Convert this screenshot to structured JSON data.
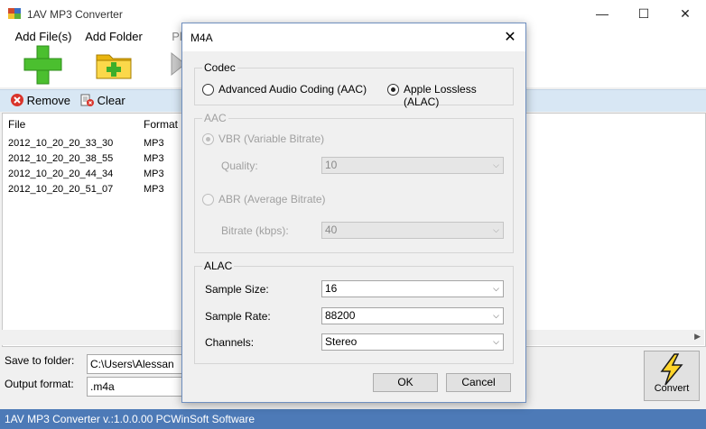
{
  "window": {
    "title": "1AV MP3 Converter",
    "minimize_icon": "minimize-icon",
    "maximize_icon": "maximize-icon",
    "close_icon": "close-icon"
  },
  "toolbar": {
    "add_files_label": "Add File(s)",
    "add_folder_label": "Add Folder",
    "play_label": "Pl"
  },
  "subbar": {
    "remove_label": "Remove",
    "clear_label": "Clear"
  },
  "file_list": {
    "columns": [
      "File",
      "Format"
    ],
    "rows": [
      {
        "file": "2012_10_20_20_33_30",
        "format": "MP3"
      },
      {
        "file": "2012_10_20_20_38_55",
        "format": "MP3"
      },
      {
        "file": "2012_10_20_20_44_34",
        "format": "MP3"
      },
      {
        "file": "2012_10_20_20_51_07",
        "format": "MP3"
      }
    ]
  },
  "bottom": {
    "save_folder_label": "Save to folder:",
    "save_folder_value": "C:\\Users\\Alessan",
    "output_format_label": "Output format:",
    "output_format_value": ".m4a",
    "convert_label": "Convert"
  },
  "status": "1AV MP3 Converter v.:1.0.0.00 PCWinSoft Software",
  "dialog": {
    "title": "M4A",
    "codec_group": "Codec",
    "codec_aac": "Advanced Audio Coding (AAC)",
    "codec_alac": "Apple Lossless (ALAC)",
    "aac_group": "AAC",
    "vbr_label": "VBR (Variable Bitrate)",
    "quality_label": "Quality:",
    "quality_value": "10",
    "abr_label": "ABR (Average Bitrate)",
    "bitrate_label": "Bitrate (kbps):",
    "bitrate_value": "40",
    "alac_group": "ALAC",
    "sample_size_label": "Sample Size:",
    "sample_size_value": "16",
    "sample_rate_label": "Sample Rate:",
    "sample_rate_value": "88200",
    "channels_label": "Channels:",
    "channels_value": "Stereo",
    "ok_label": "OK",
    "cancel_label": "Cancel"
  }
}
